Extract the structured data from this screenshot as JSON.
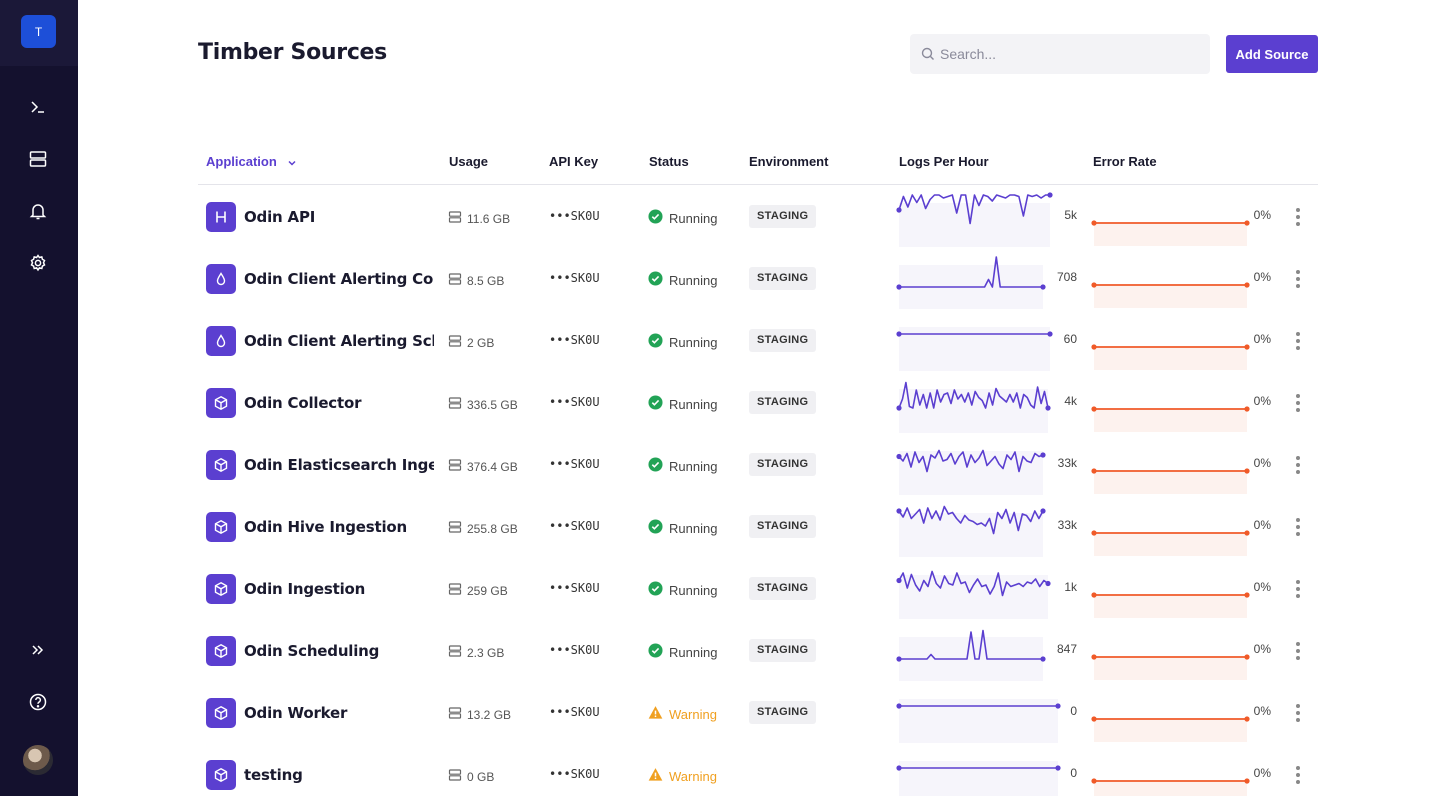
{
  "sidebar": {
    "brand_letter": "T",
    "nav": [
      {
        "name": "terminal-icon"
      },
      {
        "name": "server-icon"
      },
      {
        "name": "bell-icon"
      },
      {
        "name": "gear-icon"
      }
    ],
    "bottom": [
      {
        "name": "expand-icon"
      },
      {
        "name": "help-icon"
      }
    ]
  },
  "header": {
    "title": "Timber Sources",
    "search_placeholder": "Search...",
    "add_button": "Add Source"
  },
  "table": {
    "columns": [
      "Application",
      "Usage",
      "API Key",
      "Status",
      "Environment",
      "Logs Per Hour",
      "Error Rate"
    ],
    "rows": [
      {
        "icon": "h-icon",
        "name": "Odin API",
        "usage": "11.6 GB",
        "api_key": "•••SK0U",
        "status": "Running",
        "status_type": "ok",
        "env": "STAGING",
        "logs": "5k",
        "err": "0%",
        "series": [
          0.5,
          0.95,
          0.6,
          1,
          0.75,
          1,
          0.55,
          0.85,
          1,
          1,
          0.9,
          0.95,
          1,
          0.4,
          1,
          1,
          0.05,
          1,
          0.65,
          1,
          0.95,
          0.8,
          1,
          0.95,
          0.9,
          1,
          1,
          0.95,
          0.3,
          1,
          0.95,
          1,
          0.9,
          1,
          1
        ]
      },
      {
        "icon": "drop-icon",
        "name": "Odin Client Alerting Consumer",
        "usage": "8.5 GB",
        "api_key": "•••SK0U",
        "status": "Running",
        "status_type": "ok",
        "env": "STAGING",
        "logs": "708",
        "err": "0%",
        "series": [
          0,
          0,
          0,
          0,
          0,
          0,
          0,
          0,
          0,
          0,
          0,
          0,
          0,
          0,
          0,
          0,
          0,
          0,
          0,
          0,
          0,
          0,
          0,
          0.25,
          0,
          1,
          0,
          0,
          0,
          0,
          0,
          0,
          0,
          0,
          0,
          0,
          0,
          0
        ]
      },
      {
        "icon": "drop-icon",
        "name": "Odin Client Alerting Scheduler",
        "usage": "2 GB",
        "api_key": "•••SK0U",
        "status": "Running",
        "status_type": "ok",
        "env": "STAGING",
        "logs": "60",
        "err": "0%",
        "series": [
          0.5,
          0.5,
          0.5,
          0.5,
          0.5,
          0.5,
          0.5,
          0.5,
          0.5,
          0.5
        ]
      },
      {
        "icon": "box-icon",
        "name": "Odin Collector",
        "usage": "336.5 GB",
        "api_key": "•••SK0U",
        "status": "Running",
        "status_type": "ok",
        "env": "STAGING",
        "logs": "4k",
        "err": "0%",
        "series": [
          0.1,
          0.4,
          0.95,
          0.15,
          0.1,
          0.7,
          0.2,
          0.55,
          0.1,
          0.6,
          0.1,
          0.7,
          0.3,
          0.55,
          0.6,
          0.25,
          0.7,
          0.4,
          0.55,
          0.3,
          0.6,
          0.2,
          0.65,
          0.45,
          0.35,
          0.1,
          0.6,
          0.2,
          0.75,
          0.5,
          0.4,
          0.3,
          0.55,
          0.3,
          0.6,
          0.1,
          0.55,
          0.45,
          0.2,
          0.1,
          0.8,
          0.25,
          0.65,
          0.1
        ]
      },
      {
        "icon": "box-icon",
        "name": "Odin Elasticsearch Ingestion",
        "usage": "376.4 GB",
        "api_key": "•••SK0U",
        "status": "Running",
        "status_type": "ok",
        "env": "STAGING",
        "logs": "33k",
        "err": "0%",
        "series": [
          0.55,
          0.4,
          0.65,
          0.2,
          0.7,
          0.35,
          0.55,
          0.05,
          0.6,
          0.5,
          0.75,
          0.4,
          0.45,
          0.65,
          0.3,
          0.55,
          0.7,
          0.2,
          0.6,
          0.35,
          0.5,
          0.75,
          0.25,
          0.4,
          0.55,
          0.3,
          0.15,
          0.6,
          0.45,
          0.7,
          0.05,
          0.55,
          0.4,
          0.35,
          0.65,
          0.55,
          0.6
        ]
      },
      {
        "icon": "box-icon",
        "name": "Odin Hive Ingestion",
        "usage": "255.8 GB",
        "api_key": "•••SK0U",
        "status": "Running",
        "status_type": "ok",
        "env": "STAGING",
        "logs": "33k",
        "err": "0%",
        "series": [
          0.8,
          0.6,
          0.9,
          0.55,
          0.7,
          0.85,
          0.4,
          0.9,
          0.55,
          0.8,
          0.5,
          0.95,
          0.7,
          0.75,
          0.55,
          0.4,
          0.65,
          0.5,
          0.45,
          0.35,
          0.4,
          0.3,
          0.55,
          0.05,
          0.75,
          0.55,
          0.85,
          0.4,
          0.75,
          0.15,
          0.7,
          0.65,
          0.45,
          0.8,
          0.55,
          0.8
        ]
      },
      {
        "icon": "box-icon",
        "name": "Odin Ingestion",
        "usage": "259 GB",
        "api_key": "•••SK0U",
        "status": "Running",
        "status_type": "ok",
        "env": "STAGING",
        "logs": "1k",
        "err": "0%",
        "series": [
          0.55,
          0.8,
          0.3,
          0.75,
          0.4,
          0.2,
          0.55,
          0.35,
          0.85,
          0.45,
          0.3,
          0.7,
          0.45,
          0.4,
          0.8,
          0.45,
          0.5,
          0.15,
          0.4,
          0.6,
          0.35,
          0.4,
          0.1,
          0.35,
          0.8,
          0.05,
          0.5,
          0.35,
          0.4,
          0.45,
          0.35,
          0.5,
          0.45,
          0.6,
          0.35,
          0.55,
          0.45
        ]
      },
      {
        "icon": "box-icon",
        "name": "Odin Scheduling",
        "usage": "2.3 GB",
        "api_key": "•••SK0U",
        "status": "Running",
        "status_type": "ok",
        "env": "STAGING",
        "logs": "847",
        "err": "0%",
        "series": [
          0,
          0,
          0,
          0,
          0,
          0,
          0,
          0,
          0.15,
          0,
          0,
          0,
          0,
          0,
          0,
          0,
          0,
          0,
          0.9,
          0,
          0,
          0.95,
          0,
          0,
          0,
          0,
          0,
          0,
          0,
          0,
          0,
          0,
          0,
          0,
          0,
          0,
          0
        ]
      },
      {
        "icon": "box-icon",
        "name": "Odin Worker",
        "usage": "13.2 GB",
        "api_key": "•••SK0U",
        "status": "Warning",
        "status_type": "warn",
        "env": "STAGING",
        "logs": "0",
        "err": "0%",
        "series": [
          0.5,
          0.5,
          0.5,
          0.5,
          0.5,
          0.5,
          0.5,
          0.5,
          0.5,
          0.5
        ]
      },
      {
        "icon": "box-icon",
        "name": "testing",
        "usage": "0 GB",
        "api_key": "•••SK0U",
        "status": "Warning",
        "status_type": "warn",
        "env": "",
        "logs": "0",
        "err": "0%",
        "series": [
          0.5,
          0.5,
          0.5,
          0.5,
          0.5,
          0.5,
          0.5,
          0.5,
          0.5,
          0.5
        ]
      }
    ]
  }
}
